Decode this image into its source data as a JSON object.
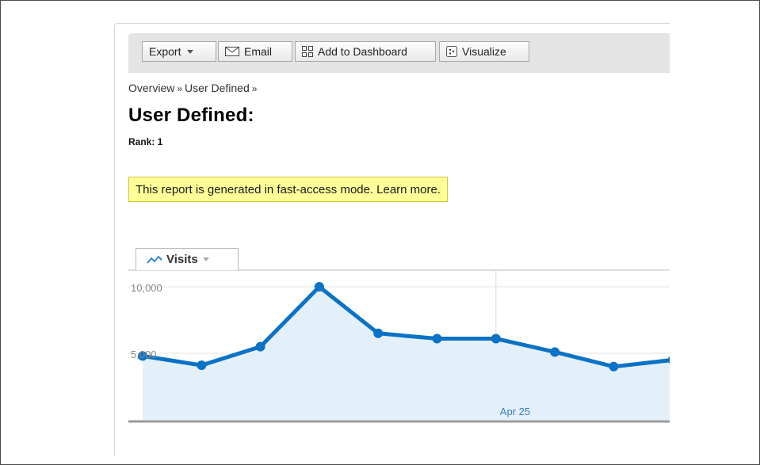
{
  "toolbar": {
    "export_label": "Export",
    "email_label": "Email",
    "add_dashboard_label": "Add to Dashboard",
    "visualize_label": "Visualize"
  },
  "breadcrumb": {
    "items": [
      "Overview",
      "User Defined"
    ],
    "separator": "»"
  },
  "page": {
    "title": "User Defined:",
    "rank": "Rank: 1"
  },
  "notice": {
    "text": "This report is generated in fast-access mode.",
    "link": "Learn more."
  },
  "chart_tab": {
    "label": "Visits"
  },
  "colors": {
    "line": "#0b72c6",
    "area": "#e3f0fa",
    "notice_bg": "#ffff99",
    "notice_border": "#d2c43a"
  },
  "icons": {
    "export": "chevron-down-icon",
    "email": "envelope-icon",
    "dashboard": "grid-icon",
    "visualize": "visualize-icon",
    "tab": "line-chart-icon"
  },
  "chart_data": {
    "type": "area",
    "series": [
      {
        "values": [
          4800,
          4100,
          5500,
          10000,
          6500,
          6100,
          6100,
          5100,
          4000,
          4500
        ]
      }
    ],
    "ylim": [
      0,
      10000
    ],
    "y_ticks": [
      "10,000",
      "5,000"
    ],
    "x_label_text": "Apr 25",
    "x_label_index": 6,
    "grid": true,
    "markers": true
  }
}
